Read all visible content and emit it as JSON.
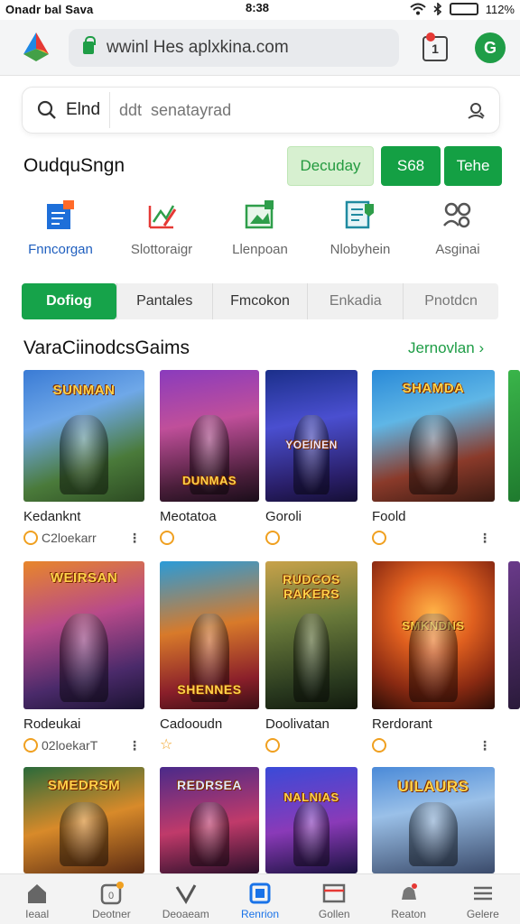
{
  "status_bar": {
    "left_text": "Onadr  bal Sava",
    "time": "8:38",
    "battery": "112%",
    "battery_fill": 0.9
  },
  "browser": {
    "url": "wwinl Hes aplxkina.com",
    "tabs_count": "1",
    "profile_initial": "G"
  },
  "search": {
    "label": "Elnd",
    "placeholder": "ddt  senatayrad"
  },
  "section": {
    "title": "OudquSngn",
    "buttons": {
      "light": "Decuday",
      "s": "S68",
      "t": "Tehe"
    }
  },
  "categories": [
    {
      "label": "Fnncorgan",
      "icon": "document-chart-icon"
    },
    {
      "label": "Slottoraigr",
      "icon": "pen-chart-icon"
    },
    {
      "label": "Llenpoan",
      "icon": "image-edit-icon"
    },
    {
      "label": "Nlobyhein",
      "icon": "news-shield-icon"
    },
    {
      "label": "Asginai",
      "icon": "people-icon"
    }
  ],
  "filters": [
    "Dofiog",
    "Pantales",
    "Fmcokon",
    "Enkadia",
    "Pnotdcn"
  ],
  "games": {
    "title": "VaraCiinodcsGaims",
    "see_all": "Jernovlan",
    "rows": [
      [
        {
          "name": "Kedanknt",
          "meta": "C2loekarr",
          "art_text": "SUNMAN"
        },
        {
          "name": "Meotatoa",
          "meta": "",
          "art_text": "DUNMAS"
        },
        {
          "name": "Goroli",
          "meta": "",
          "art_text": "YOEINEN"
        },
        {
          "name": "Foold",
          "meta": "",
          "art_text": "SHAMDA"
        }
      ],
      [
        {
          "name": "Rodeukai",
          "meta": "02loekarT",
          "art_text": "WEIRSAN"
        },
        {
          "name": "Cadooudn",
          "meta": "",
          "art_text": "SHENNES"
        },
        {
          "name": "Doolivatan",
          "meta": "",
          "art_text": "RUDCOS RAKERS"
        },
        {
          "name": "Rerdorant",
          "meta": "",
          "art_text": "SMKNDNS"
        }
      ],
      [
        {
          "name": "",
          "meta": "",
          "art_text": "SMEDRSM"
        },
        {
          "name": "",
          "meta": "",
          "art_text": "REDRSEA"
        },
        {
          "name": "",
          "meta": "",
          "art_text": "NALNIAS"
        },
        {
          "name": "",
          "meta": "",
          "art_text": "UILAURS"
        }
      ]
    ]
  },
  "bottom_nav": [
    {
      "label": "Ieaal",
      "icon": "home-icon"
    },
    {
      "label": "Deotner",
      "icon": "badge-icon"
    },
    {
      "label": "Deoaeam",
      "icon": "heart-check-icon"
    },
    {
      "label": "Renrion",
      "icon": "square-icon"
    },
    {
      "label": "Gollen",
      "icon": "window-icon"
    },
    {
      "label": "Reaton",
      "icon": "bell-icon"
    },
    {
      "label": "Gelere",
      "icon": "menu-icon"
    }
  ],
  "colors": {
    "accent": "#16a34a",
    "link": "#1e9d46",
    "active_nav": "#1a73e8"
  }
}
